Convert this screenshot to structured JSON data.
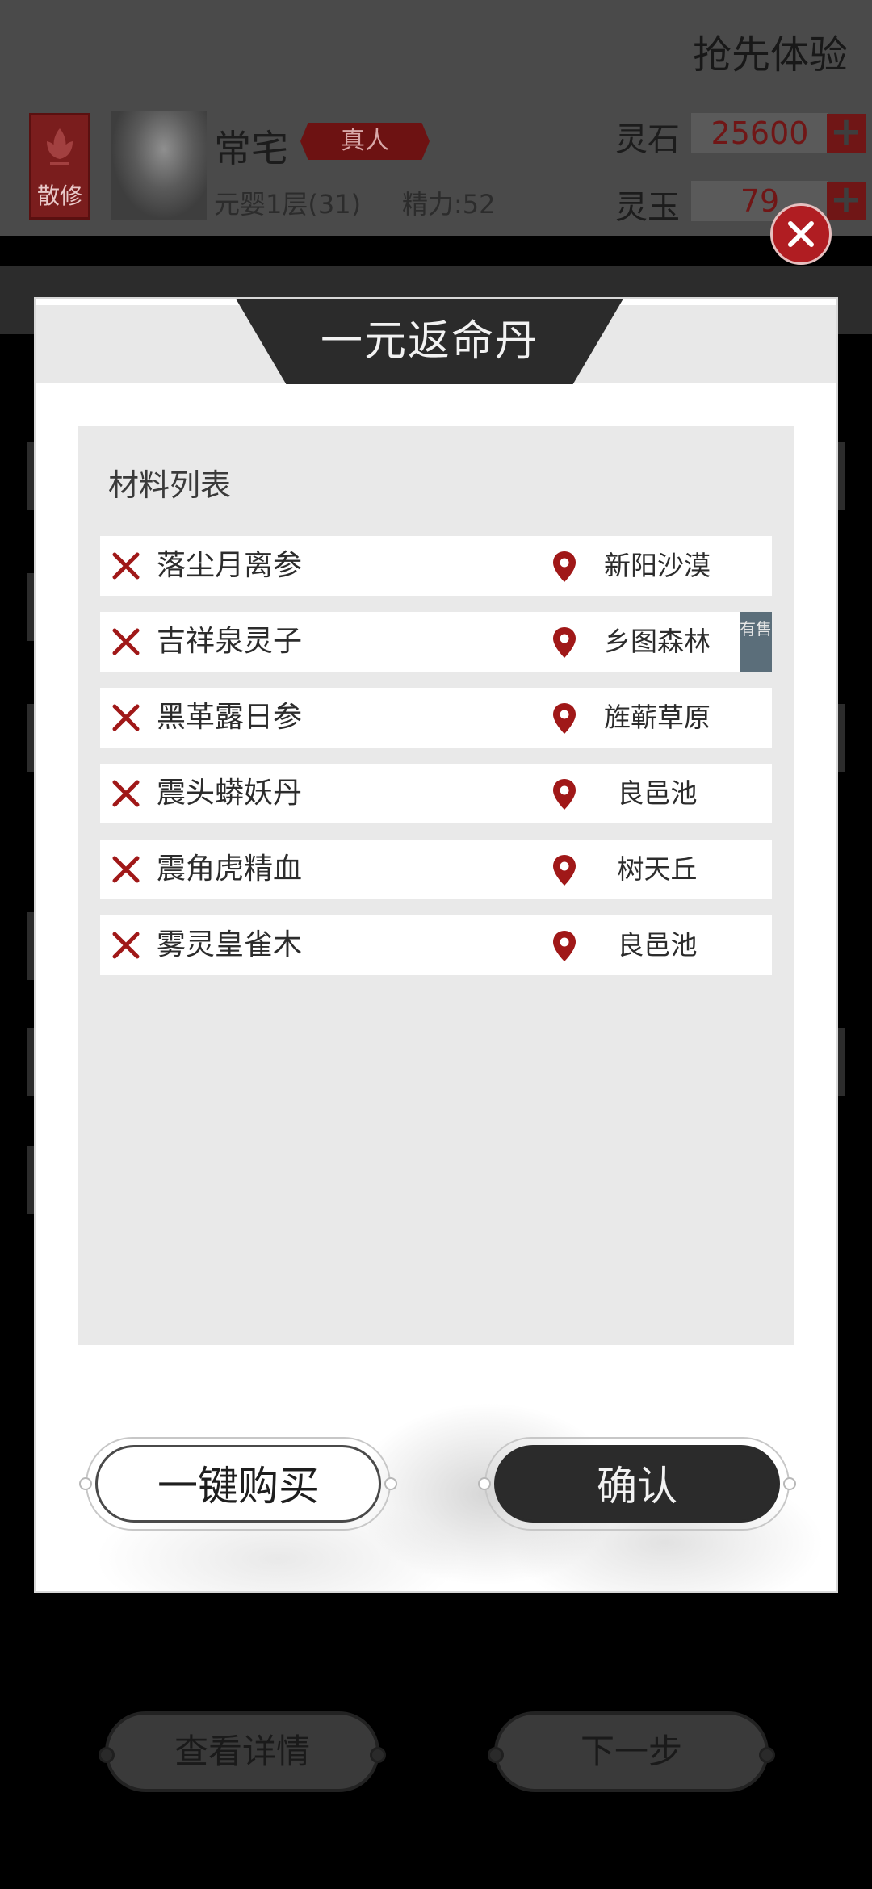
{
  "header": {
    "promo_label": "抢先体验",
    "role_badge": "散修",
    "player_name": "常宅",
    "player_tag": "真人",
    "realm": "元婴1层(31)",
    "energy": "精力:52",
    "currencies": [
      {
        "label": "灵石",
        "value": "25600",
        "add": "+"
      },
      {
        "label": "灵玉",
        "value": "79",
        "add": "+"
      }
    ]
  },
  "modal": {
    "title": "一元返命丹",
    "panel_title": "材料列表",
    "materials": [
      {
        "name": "落尘月离参",
        "location": "新阳沙漠"
      },
      {
        "name": "吉祥泉灵子",
        "location": "乡图森林",
        "badge": "有售"
      },
      {
        "name": "黑革露日参",
        "location": "旌蕲草原"
      },
      {
        "name": "震头蟒妖丹",
        "location": "良邑池"
      },
      {
        "name": "震角虎精血",
        "location": "树天丘"
      },
      {
        "name": "雾灵皇雀木",
        "location": "良邑池"
      }
    ],
    "buy_all_label": "一键购买",
    "confirm_label": "确认"
  },
  "background_buttons": {
    "details_label": "查看详情",
    "next_label": "下一步"
  },
  "colors": {
    "accent_red": "#8b1a1a",
    "close_red": "#b01d22",
    "dark": "#2b2b2b",
    "badge": "#5b6e7a"
  }
}
